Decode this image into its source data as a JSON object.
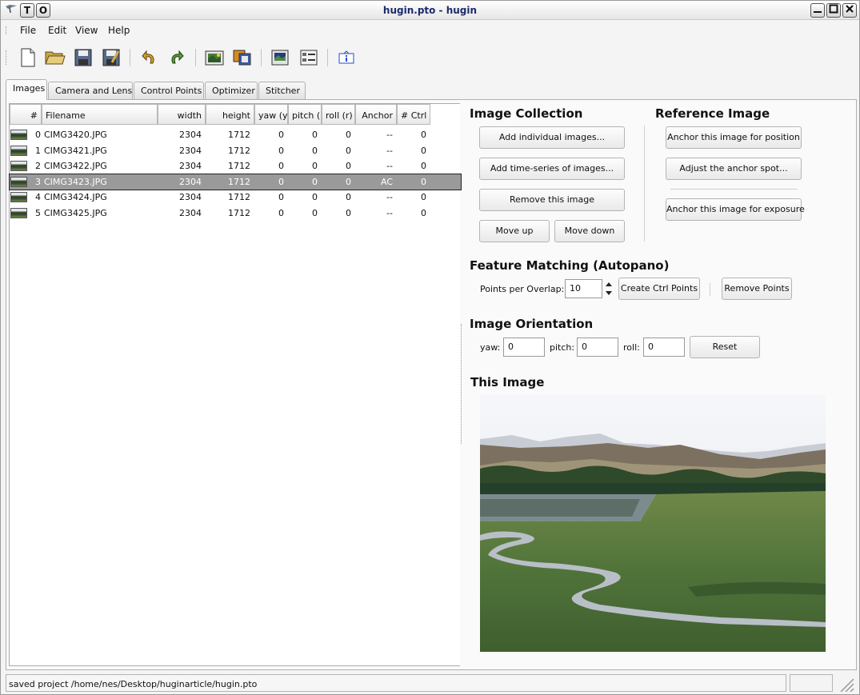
{
  "window": {
    "title": "hugin.pto - hugin",
    "left_buttons": [
      "T",
      "O"
    ]
  },
  "menu": [
    "File",
    "Edit",
    "View",
    "Help"
  ],
  "tabs": [
    "Images",
    "Camera and Lens",
    "Control Points",
    "Optimizer",
    "Stitcher"
  ],
  "table": {
    "columns": [
      "#",
      "Filename",
      "width",
      "height",
      "yaw (y)",
      "pitch (p",
      "roll (r)",
      "Anchor",
      "# Ctrl P"
    ],
    "rows": [
      {
        "num": "0",
        "file": "CIMG3420.JPG",
        "width": "2304",
        "height": "1712",
        "yaw": "0",
        "pitch": "0",
        "roll": "0",
        "anchor": "--",
        "ctrl": "0"
      },
      {
        "num": "1",
        "file": "CIMG3421.JPG",
        "width": "2304",
        "height": "1712",
        "yaw": "0",
        "pitch": "0",
        "roll": "0",
        "anchor": "--",
        "ctrl": "0"
      },
      {
        "num": "2",
        "file": "CIMG3422.JPG",
        "width": "2304",
        "height": "1712",
        "yaw": "0",
        "pitch": "0",
        "roll": "0",
        "anchor": "--",
        "ctrl": "0"
      },
      {
        "num": "3",
        "file": "CIMG3423.JPG",
        "width": "2304",
        "height": "1712",
        "yaw": "0",
        "pitch": "0",
        "roll": "0",
        "anchor": "AC",
        "ctrl": "0"
      },
      {
        "num": "4",
        "file": "CIMG3424.JPG",
        "width": "2304",
        "height": "1712",
        "yaw": "0",
        "pitch": "0",
        "roll": "0",
        "anchor": "--",
        "ctrl": "0"
      },
      {
        "num": "5",
        "file": "CIMG3425.JPG",
        "width": "2304",
        "height": "1712",
        "yaw": "0",
        "pitch": "0",
        "roll": "0",
        "anchor": "--",
        "ctrl": "0"
      }
    ],
    "selected_index": 3
  },
  "image_collection": {
    "heading": "Image Collection",
    "add_individual": "Add individual images...",
    "add_time_series": "Add time-series of images...",
    "remove": "Remove this image",
    "move_up": "Move up",
    "move_down": "Move down"
  },
  "reference_image": {
    "heading": "Reference Image",
    "anchor_position": "Anchor this image for position",
    "adjust_anchor": "Adjust the anchor spot...",
    "anchor_exposure": "Anchor this image for exposure"
  },
  "feature_matching": {
    "heading": "Feature Matching (Autopano)",
    "points_label": "Points per Overlap:",
    "points_value": "10",
    "create": "Create Ctrl Points",
    "remove": "Remove Points"
  },
  "orientation": {
    "heading": "Image Orientation",
    "yaw_label": "yaw:",
    "yaw_value": "0",
    "pitch_label": "pitch:",
    "pitch_value": "0",
    "roll_label": "roll:",
    "roll_value": "0",
    "reset": "Reset"
  },
  "this_image": {
    "heading": "This Image"
  },
  "status": {
    "text": "saved project /home/nes/Desktop/huginarticle/hugin.pto"
  },
  "icons": [
    "new-file-icon",
    "open-folder-icon",
    "save-icon",
    "save-as-icon",
    "undo-icon",
    "redo-icon",
    "add-image-icon",
    "add-series-icon",
    "preview-icon",
    "image-list-icon",
    "info-icon"
  ]
}
